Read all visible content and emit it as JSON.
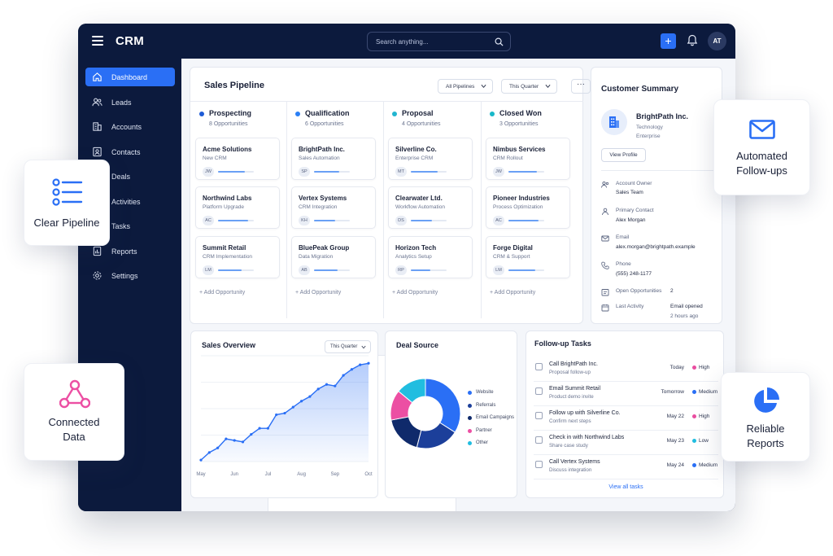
{
  "app": {
    "brand": "CRM",
    "search_placeholder": "Search anything...",
    "add_label": "+",
    "user_initials": "AT",
    "accent_color": "#2a6ff5",
    "navy_color": "#0c1a3d"
  },
  "sidebar": {
    "items": [
      {
        "label": "Dashboard",
        "icon": "home-icon",
        "active": true
      },
      {
        "label": "Leads",
        "icon": "users-icon"
      },
      {
        "label": "Accounts",
        "icon": "building-icon"
      },
      {
        "label": "Contacts",
        "icon": "contact-icon"
      },
      {
        "label": "Deals",
        "icon": "deal-icon"
      },
      {
        "label": "Activities",
        "icon": "activity-icon"
      },
      {
        "label": "Tasks",
        "icon": "task-icon"
      },
      {
        "label": "Reports",
        "icon": "report-icon"
      },
      {
        "label": "Settings",
        "icon": "gear-icon"
      }
    ]
  },
  "pipeline": {
    "title": "Sales Pipeline",
    "filter_pipelines": "All Pipelines",
    "filter_period": "This Quarter",
    "more_label": "···",
    "add_label": "+   Add Opportunity",
    "columns": [
      {
        "name": "Prospecting",
        "count": "8 Opportunities",
        "color": "#1e5bd6",
        "cards": [
          {
            "name": "Acme Solutions",
            "sub": "New CRM",
            "initials": "JW",
            "progress": 0.75
          },
          {
            "name": "Northwind Labs",
            "sub": "Platform Upgrade",
            "initials": "AC",
            "progress": 0.85
          },
          {
            "name": "Summit Retail",
            "sub": "CRM Implementation",
            "initials": "LM",
            "progress": 0.65
          }
        ]
      },
      {
        "name": "Qualification",
        "count": "6 Opportunities",
        "color": "#2a7ff5",
        "cards": [
          {
            "name": "BrightPath Inc.",
            "sub": "Sales Automation",
            "initials": "SP",
            "progress": 0.7
          },
          {
            "name": "Vertex Systems",
            "sub": "CRM Integration",
            "initials": "KH",
            "progress": 0.6
          },
          {
            "name": "BluePeak Group",
            "sub": "Data Migration",
            "initials": "AB",
            "progress": 0.65
          }
        ]
      },
      {
        "name": "Proposal",
        "count": "4 Opportunities",
        "color": "#22b5d0",
        "cards": [
          {
            "name": "Silverline Co.",
            "sub": "Enterprise CRM",
            "initials": "MT",
            "progress": 0.75
          },
          {
            "name": "Clearwater Ltd.",
            "sub": "Workflow Automation",
            "initials": "DS",
            "progress": 0.6
          },
          {
            "name": "Horizon Tech",
            "sub": "Analytics Setup",
            "initials": "RP",
            "progress": 0.55
          }
        ]
      },
      {
        "name": "Closed Won",
        "count": "3 Opportunities",
        "color": "#18b8c9",
        "cards": [
          {
            "name": "Nimbus Services",
            "sub": "CRM Rollout",
            "initials": "JW",
            "progress": 0.8
          },
          {
            "name": "Pioneer Industries",
            "sub": "Process Optimization",
            "initials": "AC",
            "progress": 0.85
          },
          {
            "name": "Forge Digital",
            "sub": "CRM & Support",
            "initials": "LM",
            "progress": 0.75
          }
        ]
      }
    ]
  },
  "customer_summary": {
    "title": "Customer Summary",
    "company": "BrightPath Inc.",
    "industry": "Technology",
    "tier": "Enterprise",
    "view_profile": "View Profile",
    "account_owner_label": "Account Owner",
    "account_owner": "Sales Team",
    "primary_contact_label": "Primary Contact",
    "primary_contact": "Alex Morgan",
    "email_label": "Email",
    "email": "alex.morgan@brightpath.example",
    "phone_label": "Phone",
    "phone": "(555) 248-1177",
    "open_opps_label": "Open Opportunities",
    "open_opps": "2",
    "last_activity_label": "Last Activity",
    "last_activity": "Email opened",
    "last_activity_time": "2 hours ago"
  },
  "sales_overview": {
    "title": "Sales Overview",
    "period": "This Quarter"
  },
  "deal_source": {
    "title": "Deal Source"
  },
  "chart_data": [
    {
      "type": "area",
      "x": [
        "May",
        "",
        "Jun",
        "",
        "Jul",
        "",
        "Aug",
        "",
        "Sep",
        "",
        "Oct"
      ],
      "points": [
        2,
        12,
        18,
        30,
        28,
        26,
        36,
        44,
        44,
        62,
        64,
        72,
        80,
        86,
        96,
        102,
        100,
        114,
        122,
        128,
        130
      ],
      "ylim": [
        0,
        140
      ],
      "grid": true,
      "color": "#2a6ff5"
    },
    {
      "type": "pie",
      "categories": [
        "Website",
        "Referrals",
        "Email Campaigns",
        "Partner",
        "Other"
      ],
      "values": [
        34,
        20,
        18,
        14,
        14
      ],
      "colors": [
        "#2a6ff5",
        "#1c3f9a",
        "#0f2a6b",
        "#ec4fa3",
        "#21bde0"
      ],
      "donut": true,
      "legend": "right"
    }
  ],
  "tasks": {
    "title": "Follow-up Tasks",
    "view_all": "View all tasks",
    "items": [
      {
        "name": "Call BrightPath Inc.",
        "sub": "Proposal follow-up",
        "due": "Today",
        "priority": "High",
        "color": "#e94da0"
      },
      {
        "name": "Email Summit Retail",
        "sub": "Product demo invite",
        "due": "Tomorrow",
        "priority": "Medium",
        "color": "#2a6ff5"
      },
      {
        "name": "Follow up with Silverline Co.",
        "sub": "Confirm next steps",
        "due": "May 22",
        "priority": "High",
        "color": "#e94da0"
      },
      {
        "name": "Check in with Northwind Labs",
        "sub": "Share case study",
        "due": "May 23",
        "priority": "Low",
        "color": "#21bde0"
      },
      {
        "name": "Call Vertex Systems",
        "sub": "Discuss integration",
        "due": "May 24",
        "priority": "Medium",
        "color": "#2a6ff5"
      }
    ]
  },
  "badges": {
    "clear_pipeline": [
      "Clear Pipeline"
    ],
    "connected_data": [
      "Connected",
      "Data"
    ],
    "automated_followups": [
      "Automated",
      "Follow-ups"
    ],
    "reliable_reports": [
      "Reliable",
      "Reports"
    ]
  }
}
